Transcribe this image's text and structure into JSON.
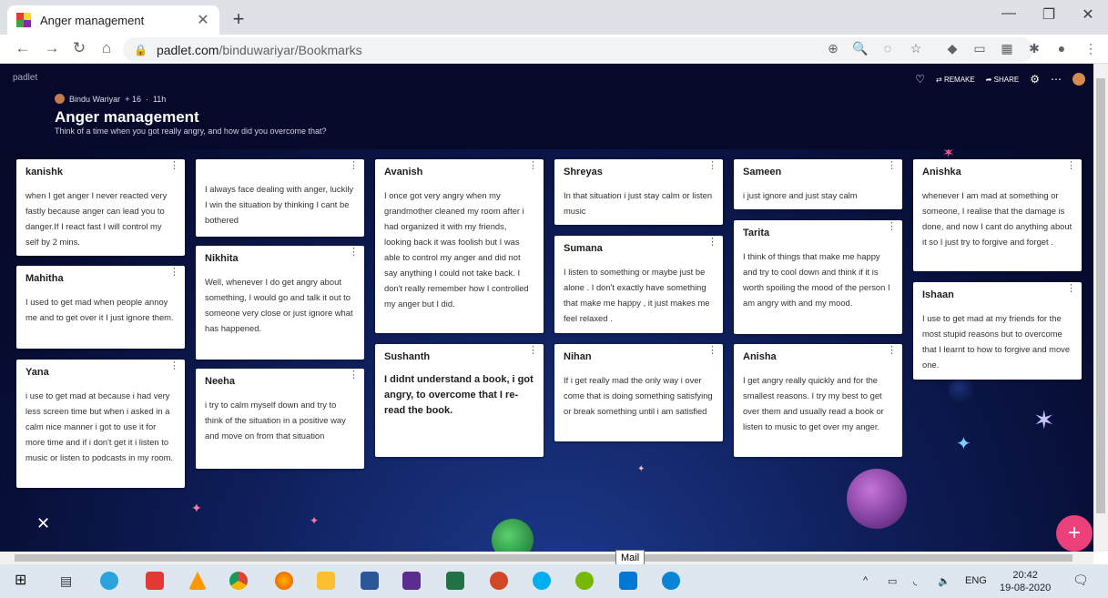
{
  "browser": {
    "tab_title": "Anger management",
    "tab_close": "✕",
    "new_tab": "+",
    "host": "padlet.com",
    "path": "/binduwariyar/Bookmarks",
    "window_controls": {
      "minimize": "—",
      "restore": "❐",
      "close": "✕"
    }
  },
  "padlet": {
    "brand": "padlet",
    "author": "Bindu Wariyar",
    "likes": "+ 16",
    "time": "11h",
    "title": "Anger management",
    "subtitle": "Think of a time when you got really angry, and how did you overcome that?",
    "actions": {
      "remake": "REMAKE",
      "share": "SHARE"
    },
    "fab": "+",
    "columns": [
      [
        {
          "name": "kanishk",
          "body": "when I get anger I never  reacted very fastly because  anger can lead you to danger.If I react fast I will  control my self  by 2 mins."
        },
        {
          "name": "Mahitha",
          "body": "I used to get mad when people annoy me and to get over it  I just ignore them."
        },
        {
          "name": "Yana",
          "body": "i use to get mad at because i had very less screen time but when i asked in a calm nice manner i got to use it for more time and if i don't get it i listen to music or listen to podcasts in my room."
        }
      ],
      [
        {
          "name": "",
          "body": "I always face dealing with anger, luckily I win the situation by thinking I cant be bothered"
        },
        {
          "name": "Nikhita",
          "body": "Well, whenever I do get angry about something, I would go and talk it out to someone very close or  just ignore what has happened."
        },
        {
          "name": "Neeha",
          "body": "i try to calm myself down and try  to  think of the situation in a positive way  and move on from that situation"
        }
      ],
      [
        {
          "name": "Avanish",
          "body": "I once got very angry when my grandmother cleaned my room after i had organized it with my friends, looking back it was foolish but I was able to control my anger and did not say anything I could not take back. I don't really remember how I controlled my anger but I did."
        },
        {
          "name": "Sushanth",
          "body": "I didnt understand a book, i got angry, to overcome that I re-read the book."
        }
      ],
      [
        {
          "name": "Shreyas",
          "body": "In that situation i just stay calm or listen music"
        },
        {
          "name": "Sumana",
          "body": "I listen to something or maybe just be alone . I don't exactly have something that make me happy , it just makes me feel relaxed ."
        },
        {
          "name": "Nihan",
          "body": "If i get really mad the only way i over come that is doing something satisfying or break something until i am  satisfied"
        }
      ],
      [
        {
          "name": "Sameen",
          "body": "i just ignore and just stay calm"
        },
        {
          "name": "Tarita",
          "body": "I think of things that make me happy and try to cool down and think if it is worth spoiling the mood of the person I am angry with  and my mood."
        },
        {
          "name": "Anisha",
          "body": "I get angry really quickly and for the smallest reasons. I try my best to get over them and usually read a book or listen to music to get over my anger."
        }
      ],
      [
        {
          "name": "Anishka",
          "body": "whenever I am mad at something or someone, I realise that the damage is done, and now I cant do anything about it so I just try to forgive and forget ."
        },
        {
          "name": "Ishaan",
          "body": "I use to get mad at my friends for the most stupid reasons but to overcome that I learnt to how to forgive and move one."
        }
      ]
    ]
  },
  "tooltip": "Mail",
  "taskbar": {
    "lang": "ENG",
    "time": "20:42",
    "date": "19-08-2020"
  },
  "colors": {
    "fab": "#ec407a",
    "board_bg": "#0b1547"
  }
}
